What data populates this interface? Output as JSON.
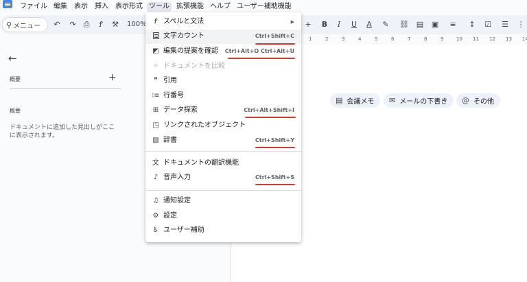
{
  "menubar": {
    "items": [
      "ファイル",
      "編集",
      "表示",
      "挿入",
      "表示形式",
      "ツール",
      "拡張機能",
      "ヘルプ",
      "ユーザー補助機能"
    ]
  },
  "toolbar": {
    "search_label": "メニュー",
    "zoom": "100%"
  },
  "ruler": {
    "labels": [
      "1",
      "2",
      "3",
      "4",
      "5",
      "6",
      "7",
      "8",
      "9",
      "10",
      "11",
      "12",
      "13",
      "14"
    ]
  },
  "sidebar": {
    "summary_label": "概要",
    "tabs_label": "概要",
    "help_text": "ドキュメントに追加した見出しがここに表示されます。"
  },
  "chips": [
    {
      "label": "会議メモ",
      "icon": "document-icon"
    },
    {
      "label": "メールの下書き",
      "icon": "mail-icon"
    },
    {
      "label": "その他",
      "icon": "at-icon"
    }
  ],
  "tools_menu": {
    "items": [
      {
        "label": "スペルと文法",
        "shortcut": "",
        "icon": "spellcheck-icon",
        "submenu": true
      },
      {
        "label": "文字カウント",
        "shortcut": "Ctrl+Shift+C",
        "icon": "word-count-icon"
      },
      {
        "label": "編集の提案を確認",
        "shortcut": "Ctrl+Alt+O Ctrl+Alt+U",
        "icon": "review-edits-icon"
      },
      {
        "label": "ドキュメントを比較",
        "shortcut": "",
        "icon": "compare-icon",
        "disabled": true
      },
      {
        "label": "引用",
        "shortcut": "",
        "icon": "quote-icon"
      },
      {
        "label": "行番号",
        "shortcut": "",
        "icon": "line-numbers-icon"
      },
      {
        "label": "データ探索",
        "shortcut": "Ctrl+Alt+Shift+I",
        "icon": "explore-icon"
      },
      {
        "label": "リンクされたオブジェクト",
        "shortcut": "",
        "icon": "linked-objects-icon"
      },
      {
        "label": "辞書",
        "shortcut": "Ctrl+Shift+Y",
        "icon": "dictionary-icon"
      },
      {
        "label": "ドキュメントの翻訳機能",
        "shortcut": "",
        "icon": "translate-icon"
      },
      {
        "label": "音声入力",
        "shortcut": "Ctrl+Shift+S",
        "icon": "microphone-icon"
      },
      {
        "label": "通知設定",
        "shortcut": "",
        "icon": "bell-icon"
      },
      {
        "label": "設定",
        "shortcut": "",
        "icon": "preferences-icon"
      },
      {
        "label": "ユーザー補助",
        "shortcut": "",
        "icon": "accessibility-icon"
      }
    ]
  },
  "colors": {
    "annotation": "#d83a2f",
    "brand": "#4285f4"
  }
}
